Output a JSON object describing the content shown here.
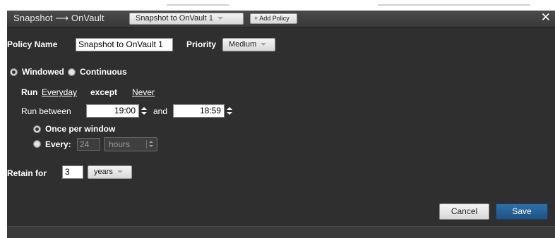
{
  "window": {
    "title": "Snapshot ⟶ OnVault",
    "policy_tab": "Snapshot to OnVault 1",
    "add_policy": "+ Add Policy",
    "close": "✕"
  },
  "policy": {
    "name_label": "Policy Name",
    "name_value": "Snapshot to OnVault 1",
    "priority_label": "Priority",
    "priority_value": "Medium"
  },
  "mode": {
    "windowed_label": "Windowed",
    "continuous_label": "Continuous",
    "selected": "Windowed"
  },
  "schedule": {
    "run_label": "Run",
    "run_value": "Everyday",
    "except_label": "except",
    "except_value": "Never",
    "run_between_label": "Run between",
    "start_time": "19:00",
    "and_label": "and",
    "end_time": "18:59",
    "once_label": "Once per window",
    "every_label": "Every:",
    "every_value": "24",
    "every_unit": "hours",
    "frequency_selected": "Once per window"
  },
  "retention": {
    "label": "Retain for",
    "value": "3",
    "unit": "years"
  },
  "buttons": {
    "cancel": "Cancel",
    "save": "Save"
  },
  "colors": {
    "background": "#2f2f2f",
    "save_button": "#1f5384",
    "text": "#ffffff"
  }
}
